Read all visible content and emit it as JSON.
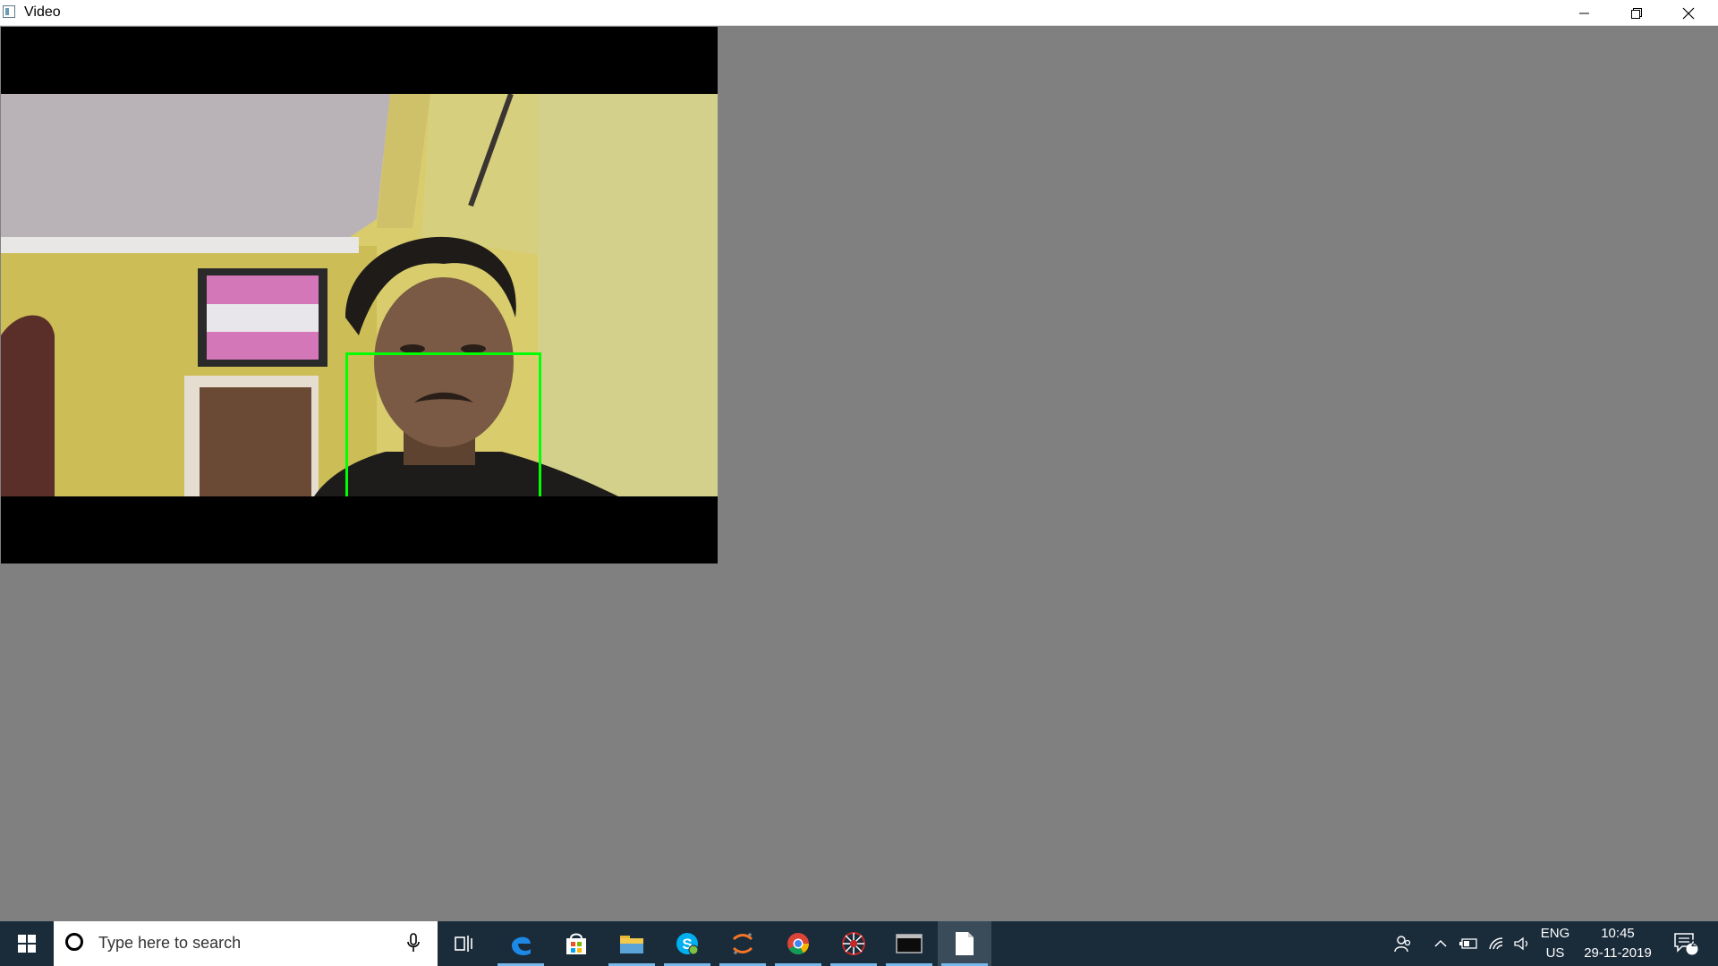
{
  "window": {
    "title": "Video",
    "icon": "video-window-icon",
    "controls": [
      "minimize-icon",
      "restore-icon",
      "close-icon"
    ]
  },
  "video": {
    "overlay": "face-detection-box",
    "overlay_color": "#00ff00"
  },
  "taskbar": {
    "search_placeholder": "Type here to search",
    "apps": [
      {
        "name": "task-view-icon"
      },
      {
        "name": "edge-icon",
        "running": true
      },
      {
        "name": "store-icon"
      },
      {
        "name": "file-explorer-icon",
        "running": true
      },
      {
        "name": "skype-icon",
        "running": true
      },
      {
        "name": "jupyter-icon",
        "running": true
      },
      {
        "name": "chrome-icon",
        "running": true
      },
      {
        "name": "spider-app-icon",
        "running": true
      },
      {
        "name": "terminal-icon",
        "running": true
      },
      {
        "name": "document-icon",
        "running": true,
        "active": true
      }
    ],
    "tray": {
      "language": "ENG",
      "region": "US",
      "time": "10:45",
      "date": "29-11-2019",
      "notification_count": "2"
    },
    "colors": {
      "taskbar_bg": "#1a2b3a",
      "running_indicator": "#76b9ed"
    }
  }
}
